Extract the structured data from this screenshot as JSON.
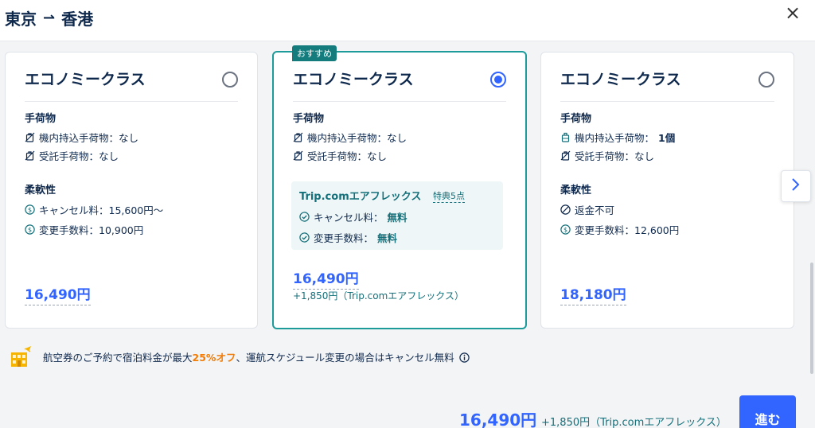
{
  "header": {
    "origin": "東京",
    "arrow": "⇀",
    "destination": "香港",
    "close_label": "×"
  },
  "cards": [
    {
      "title": "エコノミークラス",
      "selected": false,
      "baggage_title": "手荷物",
      "carry_on": "機内持込手荷物：なし",
      "checked": "受託手荷物：なし",
      "flex_title": "柔軟性",
      "cancel": "キャンセル料：15,600円～",
      "change": "変更手数料：10,900円",
      "price": "16,490円"
    },
    {
      "tag": "おすすめ",
      "title": "エコノミークラス",
      "selected": true,
      "baggage_title": "手荷物",
      "carry_on": "機内持込手荷物：なし",
      "checked": "受託手荷物：なし",
      "flex_box_title": "Trip.comエアフレックス",
      "flex_perks": "特典5点",
      "cancel_label": "キャンセル料：",
      "cancel_value": "無料",
      "change_label": "変更手数料：",
      "change_value": "無料",
      "price": "16,490円",
      "price_sub": "+1,850円（Trip.comエアフレックス）"
    },
    {
      "title": "エコノミークラス",
      "selected": false,
      "baggage_title": "手荷物",
      "carry_on_label": "機内持込手荷物：",
      "carry_on_value": "1個",
      "checked": "受託手荷物：なし",
      "flex_title": "柔軟性",
      "refund": "返金不可",
      "change": "変更手数料：12,600円",
      "price": "18,180円"
    }
  ],
  "notice": {
    "text_before": "航空券のご予約で宿泊料金が最大",
    "highlight": "25%オフ",
    "text_after": "、運航スケジュール変更の場合はキャンセル無料"
  },
  "footer": {
    "price": "16,490円",
    "price_sub": "+1,850円（Trip.comエアフレックス）",
    "button_label": "進む"
  },
  "colors": {
    "accent_blue": "#3264ff",
    "teal": "#14707a",
    "orange": "#f27c07",
    "text": "#0f294d"
  },
  "icons": {
    "no_bag": "no-baggage-icon",
    "bag": "baggage-icon",
    "dollar": "dollar-circle-icon",
    "check": "check-circle-icon",
    "no_refund": "prohibited-icon",
    "hotel": "hotel-icon",
    "info": "info-icon"
  }
}
